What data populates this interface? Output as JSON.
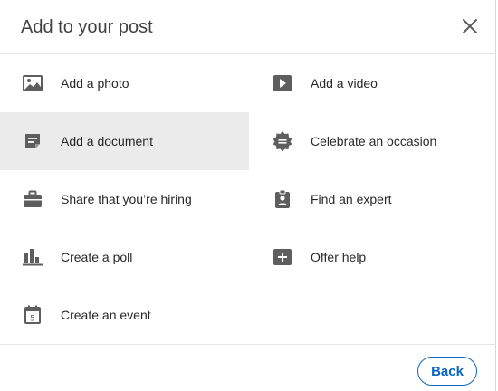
{
  "modal": {
    "title": "Add to your post",
    "close_icon": "close-icon"
  },
  "options": [
    {
      "id": "add-photo",
      "label": "Add a photo",
      "icon": "image-icon"
    },
    {
      "id": "add-video",
      "label": "Add a video",
      "icon": "video-play-icon"
    },
    {
      "id": "add-document",
      "label": "Add a document",
      "icon": "document-icon",
      "selected": true
    },
    {
      "id": "celebrate-occasion",
      "label": "Celebrate an occasion",
      "icon": "badge-burst-icon"
    },
    {
      "id": "share-hiring",
      "label": "Share that you’re hiring",
      "icon": "briefcase-icon"
    },
    {
      "id": "find-expert",
      "label": "Find an expert",
      "icon": "id-badge-icon"
    },
    {
      "id": "create-poll",
      "label": "Create a poll",
      "icon": "bar-chart-icon"
    },
    {
      "id": "offer-help",
      "label": "Offer help",
      "icon": "plus-square-icon"
    },
    {
      "id": "create-event",
      "label": "Create an event",
      "icon": "calendar-icon"
    }
  ],
  "calendar_day": "5",
  "footer": {
    "back_label": "Back"
  },
  "colors": {
    "accent": "#0a66c2",
    "icon": "#5e5e5e",
    "selected_bg": "#ebebeb"
  }
}
